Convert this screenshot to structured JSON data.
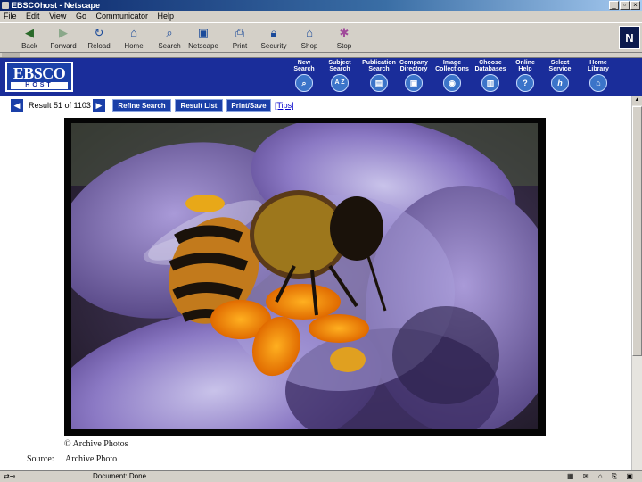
{
  "window": {
    "title": "EBSCOhost - Netscape"
  },
  "menu": [
    "File",
    "Edit",
    "View",
    "Go",
    "Communicator",
    "Help"
  ],
  "toolbar": [
    {
      "label": "Back",
      "icon": "back-arrow-icon"
    },
    {
      "label": "Forward",
      "icon": "forward-arrow-icon"
    },
    {
      "label": "Reload",
      "icon": "reload-icon"
    },
    {
      "label": "Home",
      "icon": "home-icon"
    },
    {
      "label": "Search",
      "icon": "search-icon"
    },
    {
      "label": "Netscape",
      "icon": "netscape-icon"
    },
    {
      "label": "Print",
      "icon": "print-icon"
    },
    {
      "label": "Security",
      "icon": "security-lock-icon"
    },
    {
      "label": "Shop",
      "icon": "shop-icon"
    },
    {
      "label": "Stop",
      "icon": "stop-icon"
    }
  ],
  "brand": {
    "line1": "EBSCO",
    "line2": "HOST"
  },
  "nav": [
    {
      "label": "New\nSearch",
      "glyph": "⌕",
      "icon": "new-search-icon"
    },
    {
      "label": "Subject\nSearch",
      "glyph": "A Z",
      "icon": "subject-search-icon"
    },
    {
      "label": "Publication\nSearch",
      "glyph": "▤",
      "icon": "publication-search-icon"
    },
    {
      "label": "Company\nDirectory",
      "glyph": "▣",
      "icon": "company-directory-icon"
    },
    {
      "label": "Image\nCollections",
      "glyph": "◉",
      "icon": "image-collections-icon"
    },
    {
      "label": "Choose\nDatabases",
      "glyph": "▥",
      "icon": "choose-databases-icon"
    },
    {
      "label": "Online\nHelp",
      "glyph": "?",
      "icon": "help-icon"
    },
    {
      "label": "Select\nService",
      "glyph": "h",
      "icon": "select-service-icon"
    },
    {
      "label": "Home\nLibrary",
      "glyph": "⌂",
      "icon": "home-library-icon"
    }
  ],
  "results": {
    "count_text": "Result 51 of 1103",
    "refine_label": "Refine Search",
    "list_label": "Result List",
    "print_label": "Print/Save",
    "tips_label": "[Tips]"
  },
  "image": {
    "credit": "© Archive Photos"
  },
  "source": {
    "label": "Source:",
    "value": "Archive Photo"
  },
  "status": {
    "text": "Document: Done"
  }
}
